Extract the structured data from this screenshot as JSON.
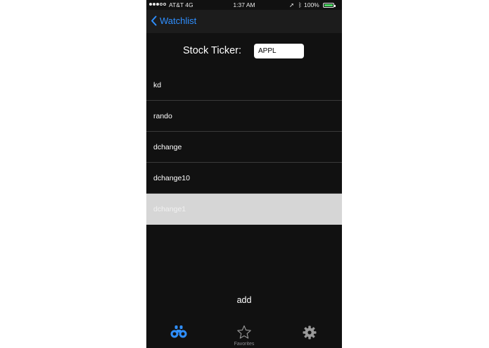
{
  "status_bar": {
    "carrier": "AT&T  4G",
    "time": "1:37 AM",
    "battery_percent": "100%",
    "battery_level": 1.0,
    "signal_bars_filled": 3,
    "signal_bars_total": 5
  },
  "nav": {
    "back_label": "Watchlist",
    "accent_color": "#2f8fff"
  },
  "ticker": {
    "label": "Stock Ticker:",
    "value": "APPL"
  },
  "list": {
    "items": [
      {
        "label": "kd"
      },
      {
        "label": "rando"
      },
      {
        "label": "dchange"
      },
      {
        "label": "dchange10"
      },
      {
        "label": "dchange1",
        "selected": true
      }
    ]
  },
  "add_label": "add",
  "tabs": [
    {
      "icon": "binoculars-icon",
      "label": "",
      "active": true
    },
    {
      "icon": "star-icon",
      "label": "Favorites",
      "active": false
    },
    {
      "icon": "gear-icon",
      "label": "",
      "active": false
    }
  ]
}
